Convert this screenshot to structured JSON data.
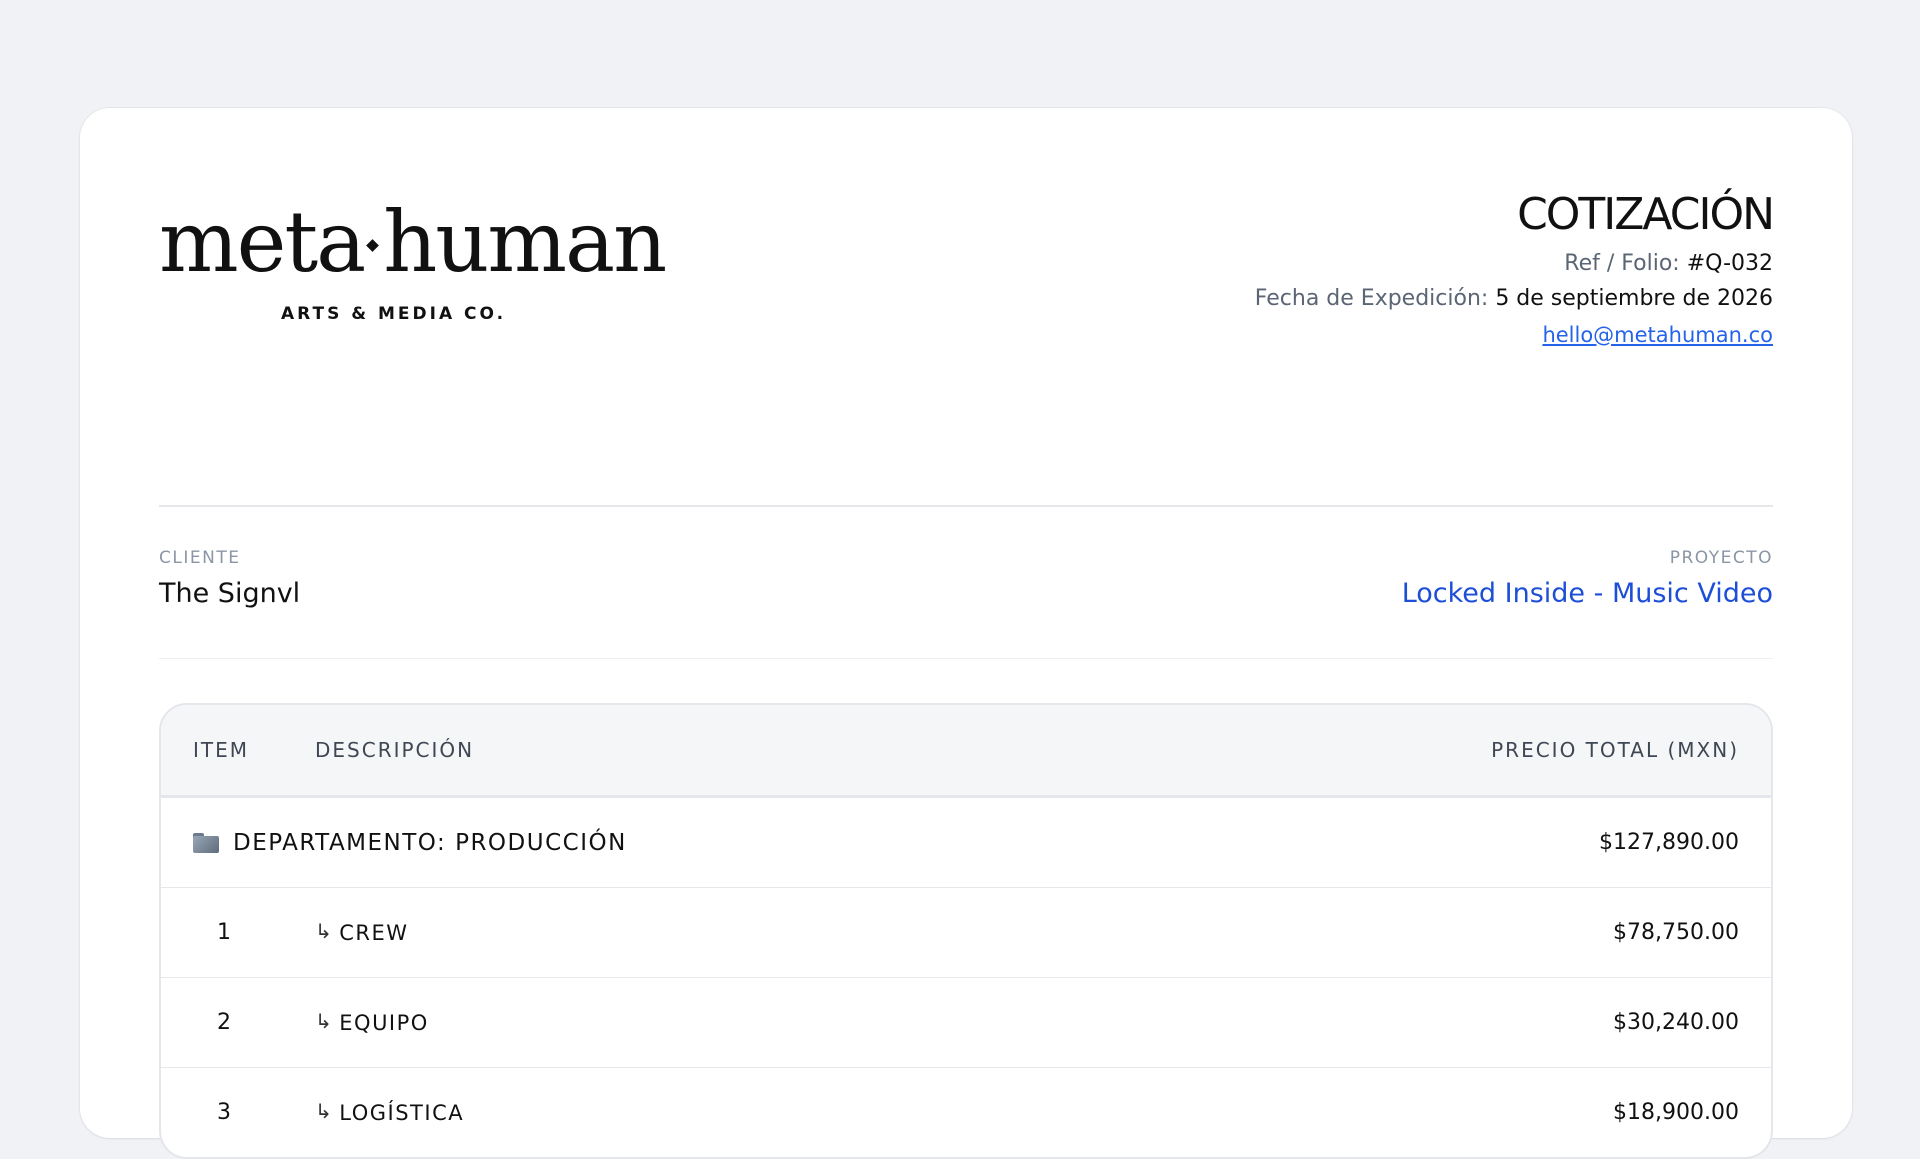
{
  "brand": {
    "name_left": "meta",
    "name_right": "human",
    "tagline": "ARTS & MEDIA CO."
  },
  "document": {
    "title": "COTIZACIÓN",
    "ref_label": "Ref / Folio:",
    "ref_value": "#Q-032",
    "date_label": "Fecha de Expedición:",
    "date_value": "5 de septiembre de 2026",
    "email": "hello@metahuman.co"
  },
  "client": {
    "label": "CLIENTE",
    "value": "The Signvl"
  },
  "project": {
    "label": "PROYECTO",
    "value": "Locked Inside - Music Video"
  },
  "table": {
    "headers": {
      "item": "ITEM",
      "description": "DESCRIPCIÓN",
      "price": "PRECIO TOTAL (MXN)"
    },
    "department": {
      "icon": "folder-icon",
      "label": "DEPARTAMENTO: PRODUCCIÓN",
      "total": "$127,890.00"
    },
    "rows": [
      {
        "item": "1",
        "description": "CREW",
        "price": "$78,750.00"
      },
      {
        "item": "2",
        "description": "EQUIPO",
        "price": "$30,240.00"
      },
      {
        "item": "3",
        "description": "LOGÍSTICA",
        "price": "$18,900.00"
      }
    ]
  },
  "colors": {
    "background": "#f0f2f5",
    "accent_link": "#2563eb",
    "project_link": "#1d4ed8",
    "muted": "#8b95a5"
  }
}
